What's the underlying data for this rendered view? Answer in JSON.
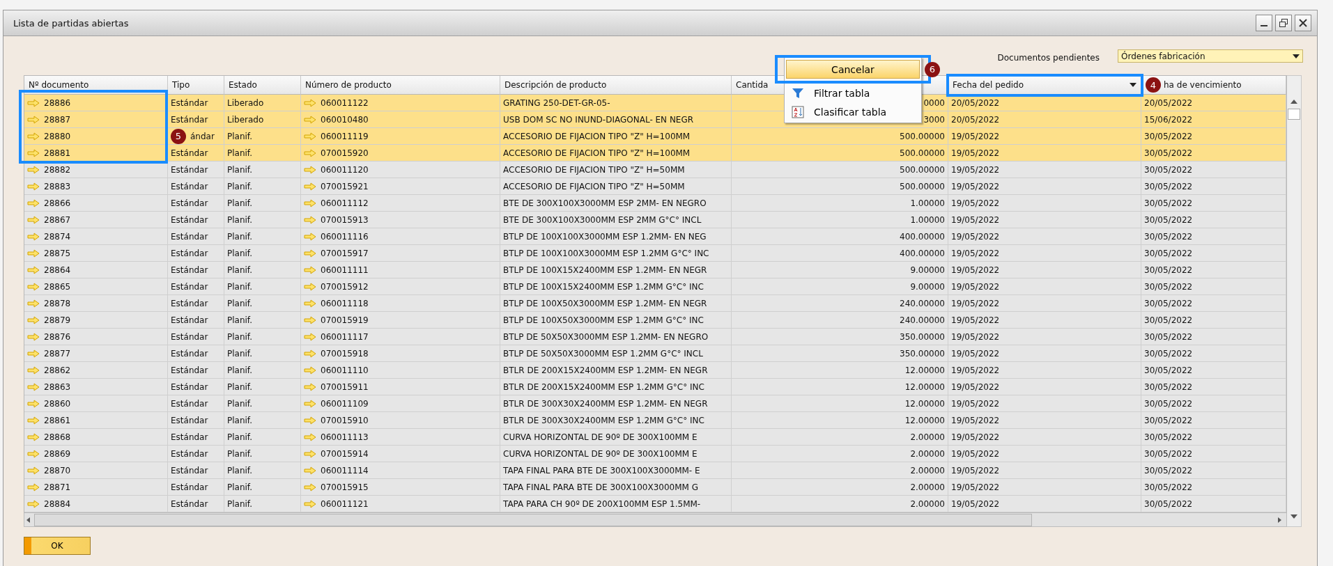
{
  "window": {
    "title": "Lista de partidas abiertas"
  },
  "filter": {
    "label": "Documentos pendientes",
    "value": "Órdenes fabricación"
  },
  "context_menu": {
    "items": [
      {
        "label": "Cancelar",
        "kind": "button",
        "badge": "6",
        "highlighted": true
      },
      {
        "label": "Filtrar tabla",
        "kind": "filter"
      },
      {
        "label": "Clasificar tabla",
        "kind": "sort"
      }
    ]
  },
  "table": {
    "columns": [
      {
        "label": "Nº documento",
        "highlighted": false,
        "sorted": false
      },
      {
        "label": "Tipo",
        "highlighted": false,
        "sorted": false
      },
      {
        "label": "Estado",
        "highlighted": false,
        "sorted": false
      },
      {
        "label": "Número de producto",
        "highlighted": false,
        "sorted": false
      },
      {
        "label": "Descripción de producto",
        "highlighted": false,
        "sorted": false
      },
      {
        "label": "Cantida",
        "highlighted": false,
        "sorted": false
      },
      {
        "label": "Fecha del pedido",
        "highlighted": true,
        "sorted": true
      },
      {
        "label": "ha de vencimiento",
        "highlighted": false,
        "sorted": false,
        "badge": "4"
      }
    ],
    "rows": [
      {
        "doc": "28886",
        "type": "Estándar",
        "status": "Liberado",
        "product": "060011122",
        "description": "GRATING 250-DET-GR-05-",
        "quantity": "0000",
        "order_date": "20/05/2022",
        "due_date": "20/05/2022",
        "selected": true,
        "outlined": true
      },
      {
        "doc": "28887",
        "type": "Estándar",
        "status": "Liberado",
        "product": "060010480",
        "description": "USB DOM SC NO INUND-DIAGONAL- EN NEGR",
        "quantity": "3000",
        "order_date": "20/05/2022",
        "due_date": "15/06/2022",
        "selected": true,
        "outlined": true
      },
      {
        "doc": "28880",
        "type": "ándar",
        "badge": "5",
        "status": "Planif.",
        "product": "060011119",
        "description": "ACCESORIO DE FIJACION TIPO \"Z\" H=100MM",
        "quantity": "500.00000",
        "order_date": "19/05/2022",
        "due_date": "30/05/2022",
        "selected": true,
        "outlined": true
      },
      {
        "doc": "28881",
        "type": "Estándar",
        "status": "Planif.",
        "product": "070015920",
        "description": "ACCESORIO DE FIJACION TIPO \"Z\" H=100MM",
        "quantity": "500.00000",
        "order_date": "19/05/2022",
        "due_date": "30/05/2022",
        "selected": true,
        "outlined": true
      },
      {
        "doc": "28882",
        "type": "Estándar",
        "status": "Planif.",
        "product": "060011120",
        "description": "ACCESORIO DE FIJACION TIPO \"Z\" H=50MM",
        "quantity": "500.00000",
        "order_date": "19/05/2022",
        "due_date": "30/05/2022",
        "selected": false,
        "outlined": false
      },
      {
        "doc": "28883",
        "type": "Estándar",
        "status": "Planif.",
        "product": "070015921",
        "description": "ACCESORIO DE FIJACION TIPO \"Z\" H=50MM",
        "quantity": "500.00000",
        "order_date": "19/05/2022",
        "due_date": "30/05/2022",
        "selected": false,
        "outlined": false
      },
      {
        "doc": "28866",
        "type": "Estándar",
        "status": "Planif.",
        "product": "060011112",
        "description": "BTE DE 300X100X3000MM ESP 2MM- EN NEGRO",
        "quantity": "1.00000",
        "order_date": "19/05/2022",
        "due_date": "30/05/2022",
        "selected": false,
        "outlined": false
      },
      {
        "doc": "28867",
        "type": "Estándar",
        "status": "Planif.",
        "product": "070015913",
        "description": "BTE DE 300X100X3000MM ESP 2MM G°C° INCL",
        "quantity": "1.00000",
        "order_date": "19/05/2022",
        "due_date": "30/05/2022",
        "selected": false,
        "outlined": false
      },
      {
        "doc": "28874",
        "type": "Estándar",
        "status": "Planif.",
        "product": "060011116",
        "description": "BTLP DE 100X100X3000MM ESP 1.2MM- EN NEG",
        "quantity": "400.00000",
        "order_date": "19/05/2022",
        "due_date": "30/05/2022",
        "selected": false,
        "outlined": false
      },
      {
        "doc": "28875",
        "type": "Estándar",
        "status": "Planif.",
        "product": "070015917",
        "description": "BTLP DE 100X100X3000MM ESP 1.2MM G°C° INC",
        "quantity": "400.00000",
        "order_date": "19/05/2022",
        "due_date": "30/05/2022",
        "selected": false,
        "outlined": false
      },
      {
        "doc": "28864",
        "type": "Estándar",
        "status": "Planif.",
        "product": "060011111",
        "description": "BTLP DE 100X15X2400MM ESP 1.2MM- EN NEGR",
        "quantity": "9.00000",
        "order_date": "19/05/2022",
        "due_date": "30/05/2022",
        "selected": false,
        "outlined": false
      },
      {
        "doc": "28865",
        "type": "Estándar",
        "status": "Planif.",
        "product": "070015912",
        "description": "BTLP DE 100X15X2400MM ESP 1.2MM G°C° INC",
        "quantity": "9.00000",
        "order_date": "19/05/2022",
        "due_date": "30/05/2022",
        "selected": false,
        "outlined": false
      },
      {
        "doc": "28878",
        "type": "Estándar",
        "status": "Planif.",
        "product": "060011118",
        "description": "BTLP DE 100X50X3000MM ESP 1.2MM- EN NEGR",
        "quantity": "240.00000",
        "order_date": "19/05/2022",
        "due_date": "30/05/2022",
        "selected": false,
        "outlined": false
      },
      {
        "doc": "28879",
        "type": "Estándar",
        "status": "Planif.",
        "product": "070015919",
        "description": "BTLP DE 100X50X3000MM ESP 1.2MM G°C° INC",
        "quantity": "240.00000",
        "order_date": "19/05/2022",
        "due_date": "30/05/2022",
        "selected": false,
        "outlined": false
      },
      {
        "doc": "28876",
        "type": "Estándar",
        "status": "Planif.",
        "product": "060011117",
        "description": "BTLP DE 50X50X3000MM ESP 1.2MM- EN NEGRO",
        "quantity": "350.00000",
        "order_date": "19/05/2022",
        "due_date": "30/05/2022",
        "selected": false,
        "outlined": false
      },
      {
        "doc": "28877",
        "type": "Estándar",
        "status": "Planif.",
        "product": "070015918",
        "description": "BTLP DE 50X50X3000MM ESP 1.2MM G°C° INCL",
        "quantity": "350.00000",
        "order_date": "19/05/2022",
        "due_date": "30/05/2022",
        "selected": false,
        "outlined": false
      },
      {
        "doc": "28862",
        "type": "Estándar",
        "status": "Planif.",
        "product": "060011110",
        "description": "BTLR DE 200X15X2400MM ESP 1.2MM- EN NEGR",
        "quantity": "12.00000",
        "order_date": "19/05/2022",
        "due_date": "30/05/2022",
        "selected": false,
        "outlined": false
      },
      {
        "doc": "28863",
        "type": "Estándar",
        "status": "Planif.",
        "product": "070015911",
        "description": "BTLR DE 200X15X2400MM ESP 1.2MM G°C° INC",
        "quantity": "12.00000",
        "order_date": "19/05/2022",
        "due_date": "30/05/2022",
        "selected": false,
        "outlined": false
      },
      {
        "doc": "28860",
        "type": "Estándar",
        "status": "Planif.",
        "product": "060011109",
        "description": "BTLR DE 300X30X2400MM ESP 1.2MM- EN NEGR",
        "quantity": "12.00000",
        "order_date": "19/05/2022",
        "due_date": "30/05/2022",
        "selected": false,
        "outlined": false
      },
      {
        "doc": "28861",
        "type": "Estándar",
        "status": "Planif.",
        "product": "070015910",
        "description": "BTLR DE 300X30X2400MM ESP 1.2MM G°C° INC",
        "quantity": "12.00000",
        "order_date": "19/05/2022",
        "due_date": "30/05/2022",
        "selected": false,
        "outlined": false
      },
      {
        "doc": "28868",
        "type": "Estándar",
        "status": "Planif.",
        "product": "060011113",
        "description": "CURVA HORIZONTAL DE 90º DE 300X100MM E",
        "quantity": "2.00000",
        "order_date": "19/05/2022",
        "due_date": "30/05/2022",
        "selected": false,
        "outlined": false
      },
      {
        "doc": "28869",
        "type": "Estándar",
        "status": "Planif.",
        "product": "070015914",
        "description": "CURVA HORIZONTAL DE 90º DE 300X100MM E",
        "quantity": "2.00000",
        "order_date": "19/05/2022",
        "due_date": "30/05/2022",
        "selected": false,
        "outlined": false
      },
      {
        "doc": "28870",
        "type": "Estándar",
        "status": "Planif.",
        "product": "060011114",
        "description": "TAPA FINAL PARA BTE DE 300X100X3000MM- E",
        "quantity": "2.00000",
        "order_date": "19/05/2022",
        "due_date": "30/05/2022",
        "selected": false,
        "outlined": false
      },
      {
        "doc": "28871",
        "type": "Estándar",
        "status": "Planif.",
        "product": "070015915",
        "description": "TAPA FINAL PARA BTE DE 300X100X3000MM G",
        "quantity": "2.00000",
        "order_date": "19/05/2022",
        "due_date": "30/05/2022",
        "selected": false,
        "outlined": false
      },
      {
        "doc": "28884",
        "type": "Estándar",
        "status": "Planif.",
        "product": "060011121",
        "description": "TAPA PARA CH 90º DE 200X100MM ESP 1.5MM-",
        "quantity": "2.00000",
        "order_date": "19/05/2022",
        "due_date": "30/05/2022",
        "selected": false,
        "outlined": false
      }
    ]
  },
  "buttons": [
    {
      "label": "OK"
    }
  ]
}
